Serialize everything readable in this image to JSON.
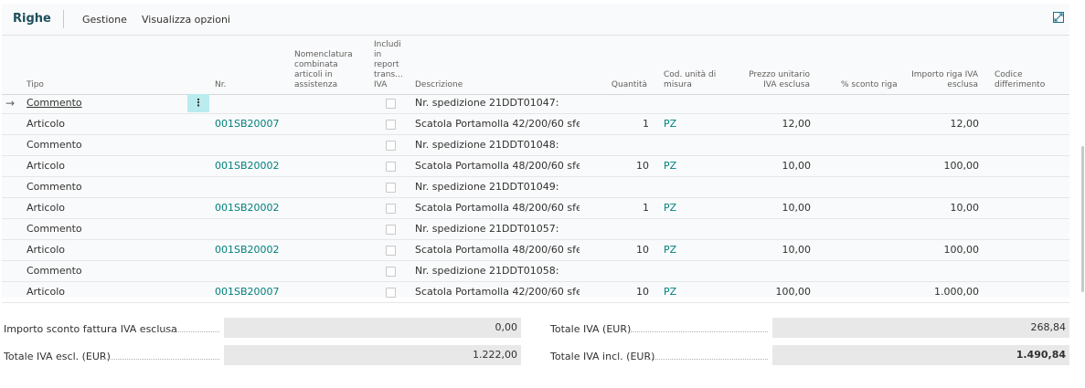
{
  "tabs": {
    "title": "Righe",
    "items": [
      "Gestione",
      "Visualizza opzioni"
    ]
  },
  "columns": {
    "tipo": "Tipo",
    "nr": "Nr.",
    "nomenclatura": [
      "Nomenclatura",
      "combinata",
      "articoli in",
      "assistenza"
    ],
    "includi": [
      "Includi",
      "in",
      "report",
      "trans...",
      "IVA"
    ],
    "descrizione": "Descrizione",
    "quantita": "Quantità",
    "cod_unita": [
      "Cod. unità di",
      "misura"
    ],
    "prezzo": [
      "Prezzo unitario",
      "IVA esclusa"
    ],
    "sconto": "% sconto riga",
    "importo": [
      "Importo riga IVA",
      "esclusa"
    ],
    "codice": [
      "Codice",
      "differimento"
    ]
  },
  "rows": [
    {
      "tipo": "Commento",
      "nr": "",
      "descrizione": "Nr. spedizione 21DDT01047:",
      "quantita": "",
      "unita": "",
      "prezzo": "",
      "importo": ""
    },
    {
      "tipo": "Articolo",
      "nr": "001SB20007",
      "descrizione": "Scatola Portamolla 42/200/60 sfe...",
      "quantita": "1",
      "unita": "PZ",
      "prezzo": "12,00",
      "importo": "12,00"
    },
    {
      "tipo": "Commento",
      "nr": "",
      "descrizione": "Nr. spedizione 21DDT01048:",
      "quantita": "",
      "unita": "",
      "prezzo": "",
      "importo": ""
    },
    {
      "tipo": "Articolo",
      "nr": "001SB20002",
      "descrizione": "Scatola Portamolla 48/200/60 sfe...",
      "quantita": "10",
      "unita": "PZ",
      "prezzo": "10,00",
      "importo": "100,00"
    },
    {
      "tipo": "Commento",
      "nr": "",
      "descrizione": "Nr. spedizione 21DDT01049:",
      "quantita": "",
      "unita": "",
      "prezzo": "",
      "importo": ""
    },
    {
      "tipo": "Articolo",
      "nr": "001SB20002",
      "descrizione": "Scatola Portamolla 48/200/60 sfe...",
      "quantita": "1",
      "unita": "PZ",
      "prezzo": "10,00",
      "importo": "10,00"
    },
    {
      "tipo": "Commento",
      "nr": "",
      "descrizione": "Nr. spedizione 21DDT01057:",
      "quantita": "",
      "unita": "",
      "prezzo": "",
      "importo": ""
    },
    {
      "tipo": "Articolo",
      "nr": "001SB20002",
      "descrizione": "Scatola Portamolla 48/200/60 sfe...",
      "quantita": "10",
      "unita": "PZ",
      "prezzo": "10,00",
      "importo": "100,00"
    },
    {
      "tipo": "Commento",
      "nr": "",
      "descrizione": "Nr. spedizione 21DDT01058:",
      "quantita": "",
      "unita": "",
      "prezzo": "",
      "importo": ""
    },
    {
      "tipo": "Articolo",
      "nr": "001SB20007",
      "descrizione": "Scatola Portamolla 42/200/60 sfe...",
      "quantita": "10",
      "unita": "PZ",
      "prezzo": "100,00",
      "importo": "1.000,00"
    }
  ],
  "totals": {
    "sconto_label": "Importo sconto fattura IVA esclusa",
    "sconto_value": "0,00",
    "iva_escl_label": "Totale IVA escl. (EUR)",
    "iva_escl_value": "1.222,00",
    "iva_label": "Totale IVA (EUR)",
    "iva_value": "268,84",
    "iva_incl_label": "Totale IVA incl. (EUR)",
    "iva_incl_value": "1.490,84"
  },
  "icons": {
    "current_row": "arrow-right-icon",
    "row_menu": "more-vertical-icon",
    "expand": "expand-icon"
  }
}
